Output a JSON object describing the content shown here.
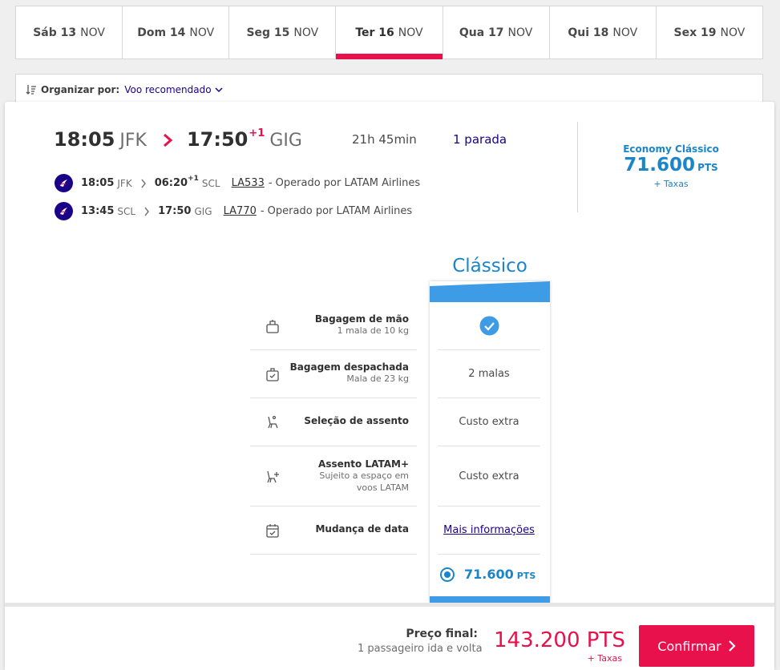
{
  "dates": [
    {
      "day": "Sáb 13",
      "month": "NOV",
      "active": false
    },
    {
      "day": "Dom 14",
      "month": "NOV",
      "active": false
    },
    {
      "day": "Seg 15",
      "month": "NOV",
      "active": false
    },
    {
      "day": "Ter 16",
      "month": "NOV",
      "active": true
    },
    {
      "day": "Qua 17",
      "month": "NOV",
      "active": false
    },
    {
      "day": "Qui 18",
      "month": "NOV",
      "active": false
    },
    {
      "day": "Sex 19",
      "month": "NOV",
      "active": false
    }
  ],
  "sort": {
    "label": "Organizar por:",
    "value": "Voo recomendado"
  },
  "itinerary": {
    "depart_time": "18:05",
    "depart_code": "JFK",
    "arrive_time": "17:50",
    "arrive_plus": "+1",
    "arrive_code": "GIG",
    "duration": "21h 45min",
    "stops": "1 parada"
  },
  "segments": [
    {
      "dep_time": "18:05",
      "dep_code": "JFK",
      "arr_time": "06:20",
      "arr_plus": "+1",
      "arr_code": "SCL",
      "flight": "LA533",
      "operated": "- Operado por LATAM Airlines"
    },
    {
      "dep_time": "13:45",
      "dep_code": "SCL",
      "arr_time": "17:50",
      "arr_plus": "",
      "arr_code": "GIG",
      "flight": "LA770",
      "operated": "- Operado por LATAM Airlines"
    }
  ],
  "fare_summary": {
    "brand": "Economy Clássico",
    "price": "71.600",
    "unit": "PTS",
    "taxes": "+ Taxas"
  },
  "classic": {
    "title": "Clássico",
    "features": [
      {
        "title": "Bagagem de mão",
        "subtitle": "1 mala de 10 kg",
        "value": ""
      },
      {
        "title": "Bagagem despachada",
        "subtitle": "Mala de 23 kg",
        "value": "2 malas"
      },
      {
        "title": "Seleção de assento",
        "subtitle": "",
        "value": "Custo extra"
      },
      {
        "title": "Assento LATAM+",
        "subtitle": "Sujeito a espaço em voos LATAM",
        "value": "Custo extra"
      },
      {
        "title": "Mudança de data",
        "subtitle": "",
        "value": "Mais informações"
      }
    ],
    "price": "71.600",
    "unit": "PTS"
  },
  "footer": {
    "label": "Preço final:",
    "passengers": "1 passageiro ida e volta",
    "price": "143.200 PTS",
    "taxes": "+ Taxas",
    "confirm": "Confirmar"
  },
  "colors": {
    "brand_red": "#e8114b",
    "brand_blue": "#1a85c8",
    "latam_navy": "#1b0088",
    "column_blue": "#3e9be5"
  }
}
